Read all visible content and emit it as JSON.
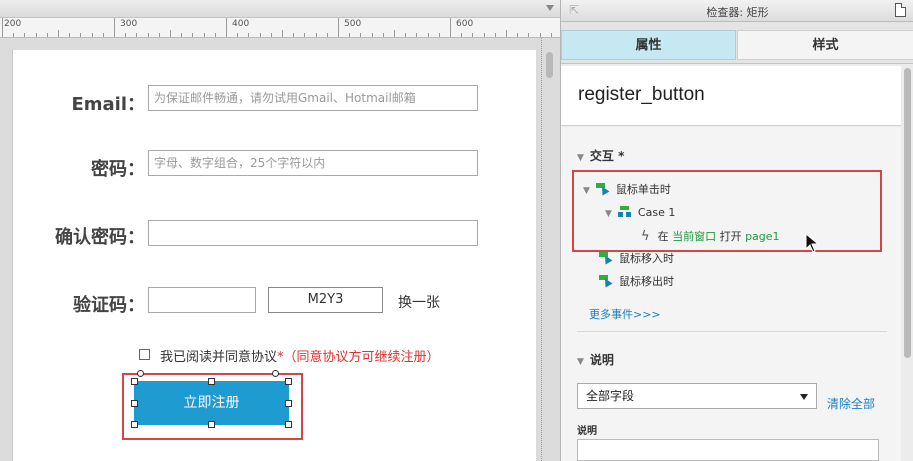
{
  "ruler": {
    "marks": [
      "200",
      "300",
      "400",
      "500",
      "600"
    ]
  },
  "form": {
    "email_label": "Email：",
    "email_placeholder": "为保证邮件畅通，请勿试用Gmail、Hotmail邮箱",
    "password_label": "密码：",
    "password_placeholder": "字母、数字组合，25个字符以内",
    "confirm_label": "确认密码：",
    "confirm_value": "",
    "captcha_label": "验证码：",
    "captcha_value": "",
    "captcha_code": "M2Y3",
    "change_label": "换一张",
    "agree_text": "我已阅读并同意协议",
    "agree_required": "*（同意协议方可继续注册）",
    "register_label": "立即注册"
  },
  "inspector": {
    "title": "检查器: 矩形",
    "tabs": [
      "属性",
      "样式"
    ],
    "element_name": "register_button",
    "interaction_header": "交互 *",
    "events": {
      "on_click": "鼠标单击时",
      "case_name": "Case 1",
      "action_prefix": "在",
      "action_target": "当前窗口",
      "action_verb": "打开",
      "action_page": "page1",
      "on_mouse_enter": "鼠标移入时",
      "on_mouse_leave": "鼠标移出时",
      "more_events": "更多事件>>>"
    },
    "notes_header": "说明",
    "field_select": "全部字段",
    "clear_all": "清除全部",
    "notes_label": "说明"
  },
  "colors": {
    "button": "#1e9bd1",
    "selection": "#d64545",
    "active_tab": "#c5e8f2",
    "link": "#1a7fc1",
    "action_green": "#1c9b3c"
  }
}
